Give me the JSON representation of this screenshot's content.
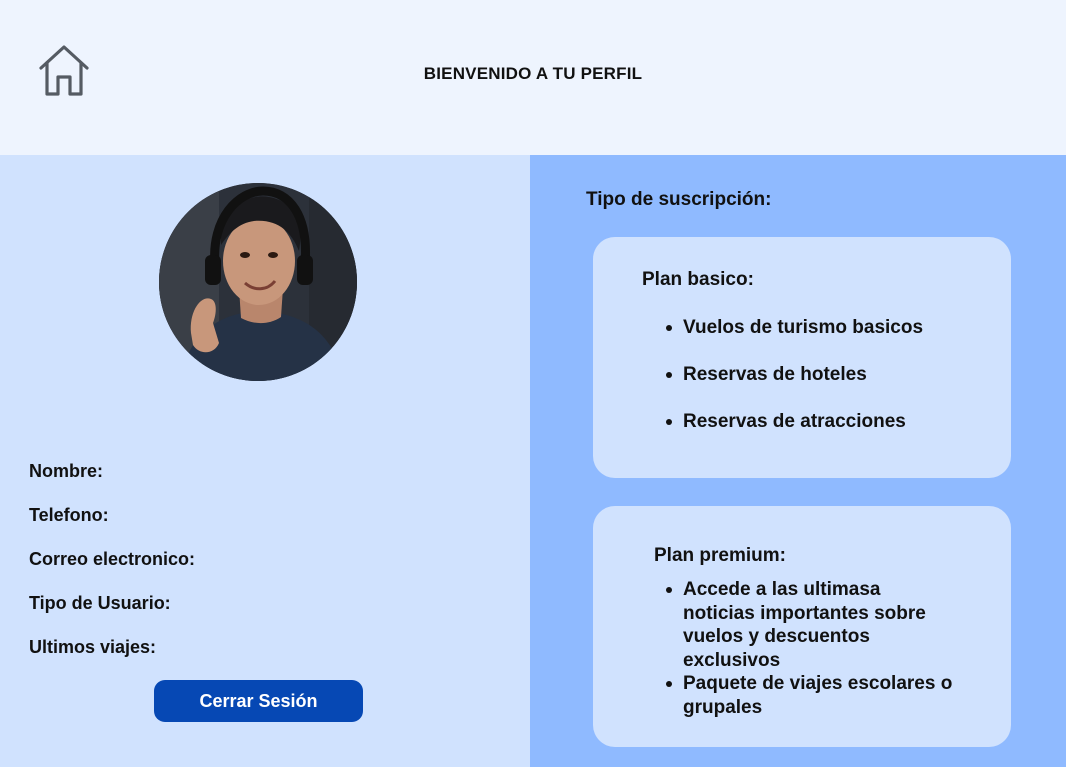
{
  "header": {
    "title": "BIENVENIDO A TU PERFIL",
    "home_icon": "home-icon"
  },
  "profile": {
    "avatar": "user-avatar-photo",
    "fields": [
      {
        "label": "Nombre:"
      },
      {
        "label": "Telefono:"
      },
      {
        "label": "Correo electronico:"
      },
      {
        "label": "Tipo de Usuario:"
      },
      {
        "label": "Ultimos viajes:"
      }
    ],
    "logout_label": "Cerrar Sesión"
  },
  "subscription": {
    "title": "Tipo de suscripción:",
    "plans": [
      {
        "name": "Plan basico:",
        "features": [
          "Vuelos de turismo basicos",
          "Reservas de hoteles",
          "Reservas de atracciones"
        ]
      },
      {
        "name": "Plan premium:",
        "features": [
          "Accede a las ultimasa noticias importantes sobre vuelos y descuentos exclusivos",
          "Paquete de viajes escolares o grupales"
        ]
      }
    ]
  },
  "colors": {
    "header_bg": "#eef4fe",
    "left_panel_bg": "#d0e2fe",
    "right_panel_bg": "#8fbaff",
    "card_bg": "#d0e2fe",
    "button_bg": "#0648b4"
  }
}
